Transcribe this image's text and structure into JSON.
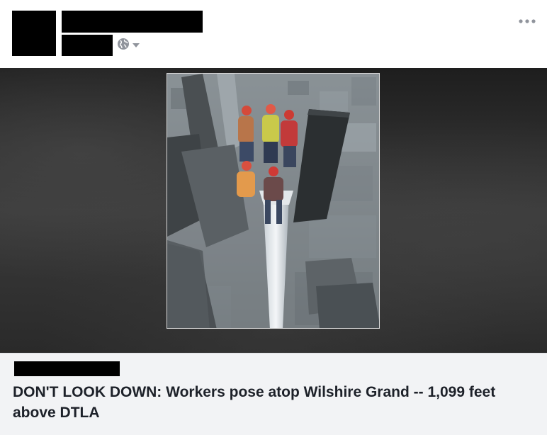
{
  "post": {
    "privacy": {
      "icon": "globe-icon",
      "dropdown_icon": "caret-down-icon"
    },
    "more_options": {
      "icon": "more-horizontal-icon",
      "label": "•••"
    },
    "link_preview": {
      "title": "DON'T LOOK DOWN: Workers pose atop Wilshire Grand -- 1,099 feet above DTLA"
    },
    "colors": {
      "link_box_bg": "#f2f3f5",
      "title_text": "#1d2129",
      "icon_gray": "#90949c",
      "redaction": "#000000"
    }
  }
}
